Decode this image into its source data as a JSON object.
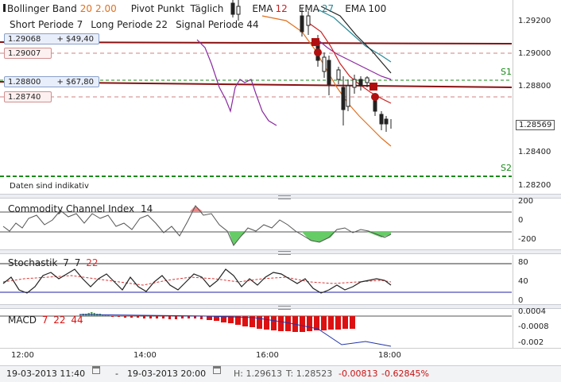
{
  "main_legend": {
    "bollinger": {
      "label": "Bollinger Band",
      "p1": "20",
      "p2": "2.00"
    },
    "pivot": "Pivot Punkt  Täglich",
    "ema1": {
      "label": "EMA",
      "value": "12"
    },
    "ema2": {
      "label": "EMA",
      "value": "27"
    },
    "ema3": {
      "label": "EMA",
      "value": "100"
    },
    "line2": {
      "short_label": "Short Periode",
      "short_value": "7",
      "long_label": "Long Periode",
      "long_value": "22",
      "signal_label": "Signal Periode",
      "signal_value": "44"
    }
  },
  "price_tags": [
    {
      "price": "1.29068",
      "pl": "+ $49,40"
    },
    {
      "price": "1.29007",
      "pl": ""
    },
    {
      "price": "1.28800",
      "pl": "+ $67,80"
    },
    {
      "price": "1.28740",
      "pl": ""
    }
  ],
  "levels": {
    "s1": "S1",
    "s2": "S2"
  },
  "disclaimer": "Daten sind indikativ",
  "price_axis": {
    "ticks": [
      "1.29200",
      "1.29000",
      "1.28800",
      "1.28400",
      "1.28200"
    ],
    "current": "1.28569"
  },
  "cci": {
    "label": "Commodity Channel Index",
    "period": "14",
    "ticks": [
      "200",
      "0",
      "-200"
    ]
  },
  "stoch": {
    "label": "Stochastik",
    "p1": "7",
    "p2": "7",
    "p3": "22",
    "ticks": [
      "80",
      "40",
      "0"
    ]
  },
  "macd": {
    "label": "MACD",
    "p1": "7",
    "p2": "22",
    "p3": "44",
    "ticks": [
      "0.0004",
      "-0.0008",
      "-0.002"
    ]
  },
  "time_axis": [
    "12:00",
    "14:00",
    "16:00",
    "18:00"
  ],
  "status": {
    "from": "19-03-2013 11:40",
    "dash": "-",
    "to": "19-03-2013 20:00",
    "high": "H: 1.29613",
    "last": "T: 1.28523",
    "change": "-0.00813",
    "change_pct": "-0.62845%"
  },
  "colors": {
    "ema12": "#cc2020",
    "ema27": "#2a8a9a",
    "ema100": "#222222",
    "bollinger": "#e07020",
    "pivot": "#8a1010",
    "support": "#1a8a1a",
    "cci_fill": "#66cc66",
    "macd_bar": "#dd1111"
  }
}
